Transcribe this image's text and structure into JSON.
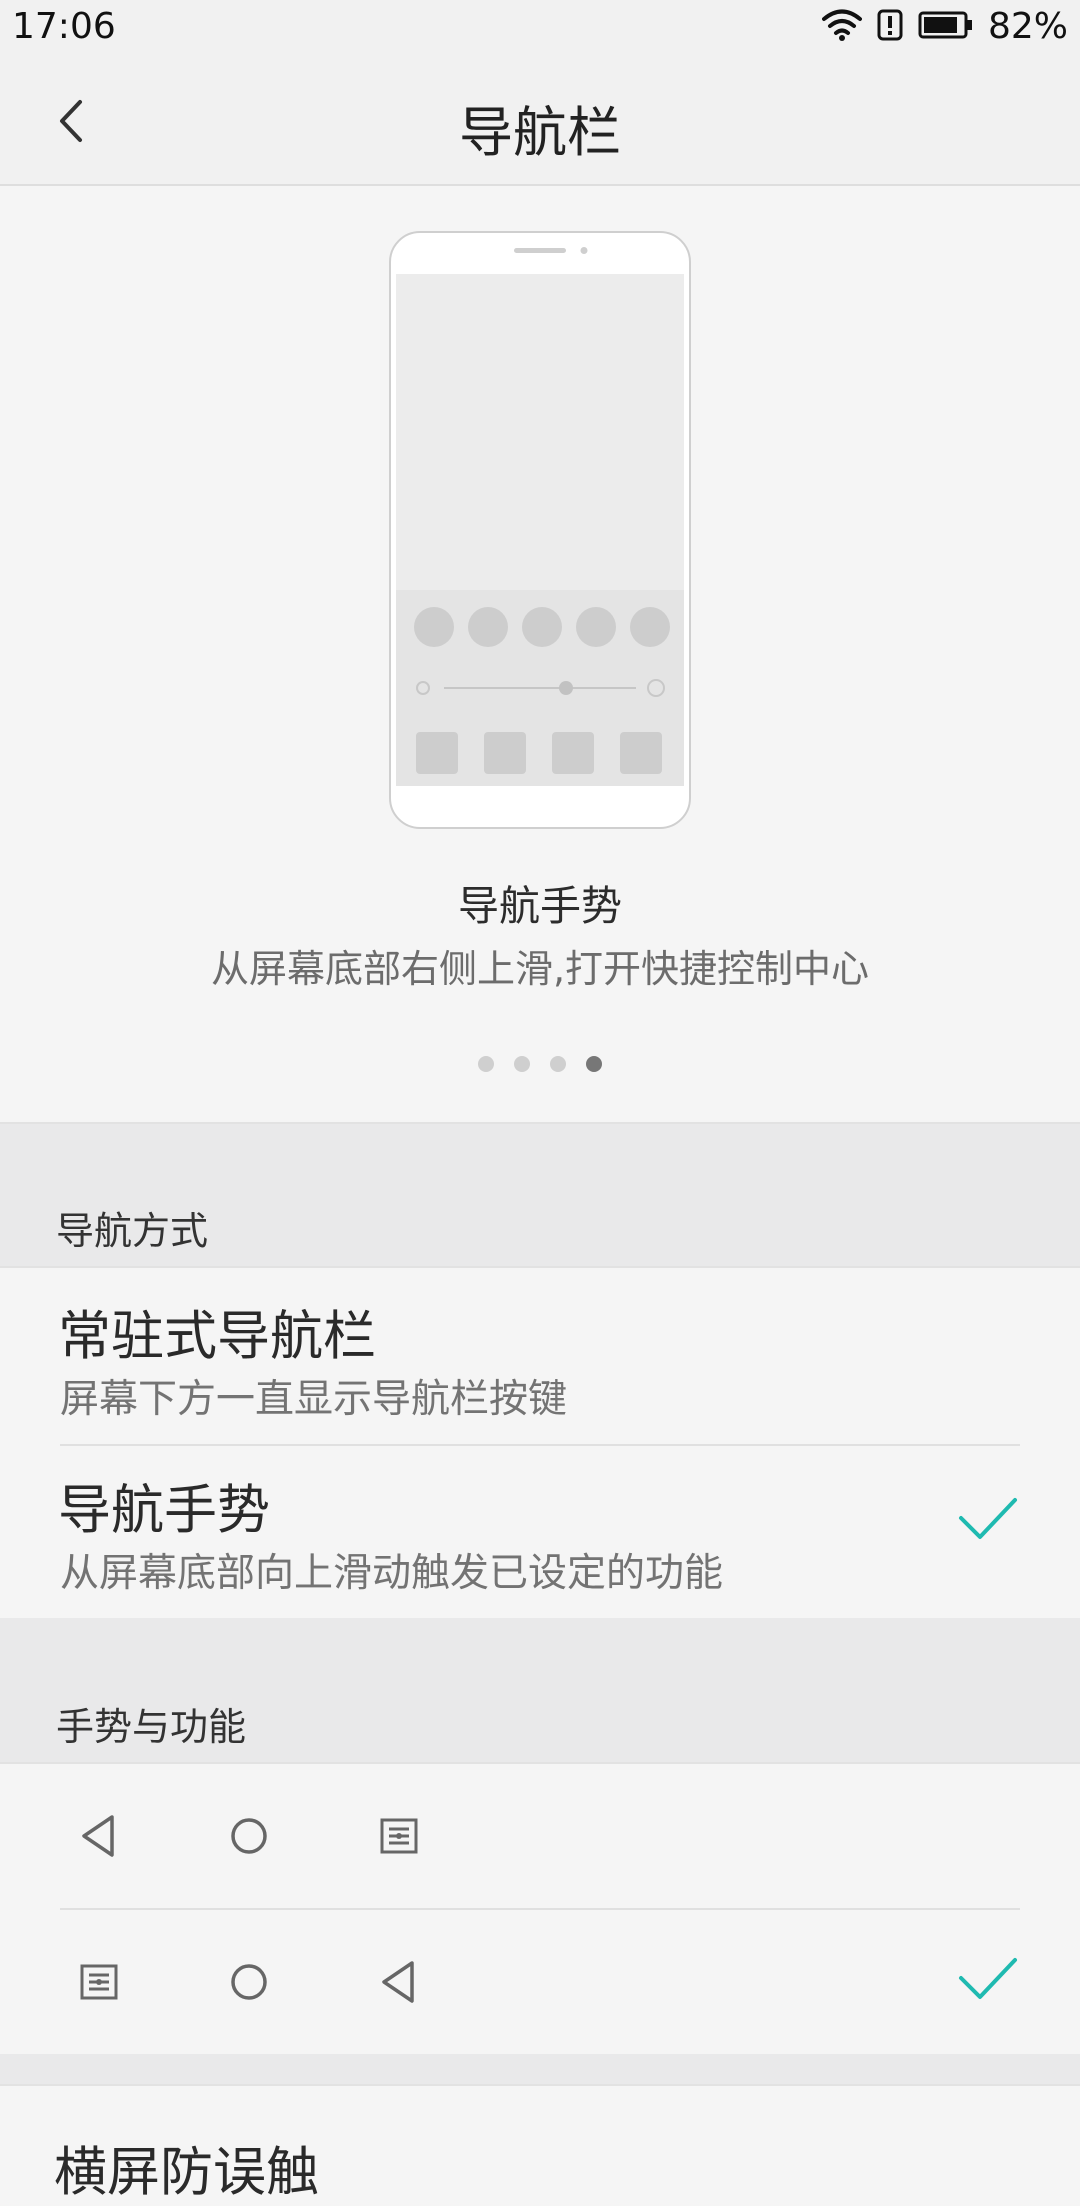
{
  "status_bar": {
    "time": "17:06",
    "battery_percent": "82%",
    "battery_level": 0.82,
    "icons": [
      "wifi-icon",
      "alert-icon",
      "battery-icon"
    ]
  },
  "header": {
    "title": "导航栏",
    "back_icon": "chevron-left-icon"
  },
  "preview": {
    "title": "导航手势",
    "description": "从屏幕底部右侧上滑,打开快捷控制中心",
    "page_count": 4,
    "active_page": 4
  },
  "nav_mode": {
    "section_label": "导航方式",
    "options": [
      {
        "title": "常驻式导航栏",
        "subtitle": "屏幕下方一直显示导航栏按键",
        "selected": false
      },
      {
        "title": "导航手势",
        "subtitle": "从屏幕底部向上滑动触发已设定的功能",
        "selected": true
      }
    ]
  },
  "gestures": {
    "section_label": "手势与功能",
    "layouts": [
      {
        "icons": [
          "back-triangle-icon",
          "home-circle-icon",
          "menu-icon"
        ],
        "selected": false
      },
      {
        "icons": [
          "menu-icon",
          "home-circle-icon",
          "back-triangle-icon"
        ],
        "selected": true
      }
    ]
  },
  "bottom": {
    "partial_title": "横屏防误触"
  },
  "colors": {
    "accent": "#1fbab0",
    "background": "#f5f5f5",
    "section_bg": "#e9e9ea"
  }
}
